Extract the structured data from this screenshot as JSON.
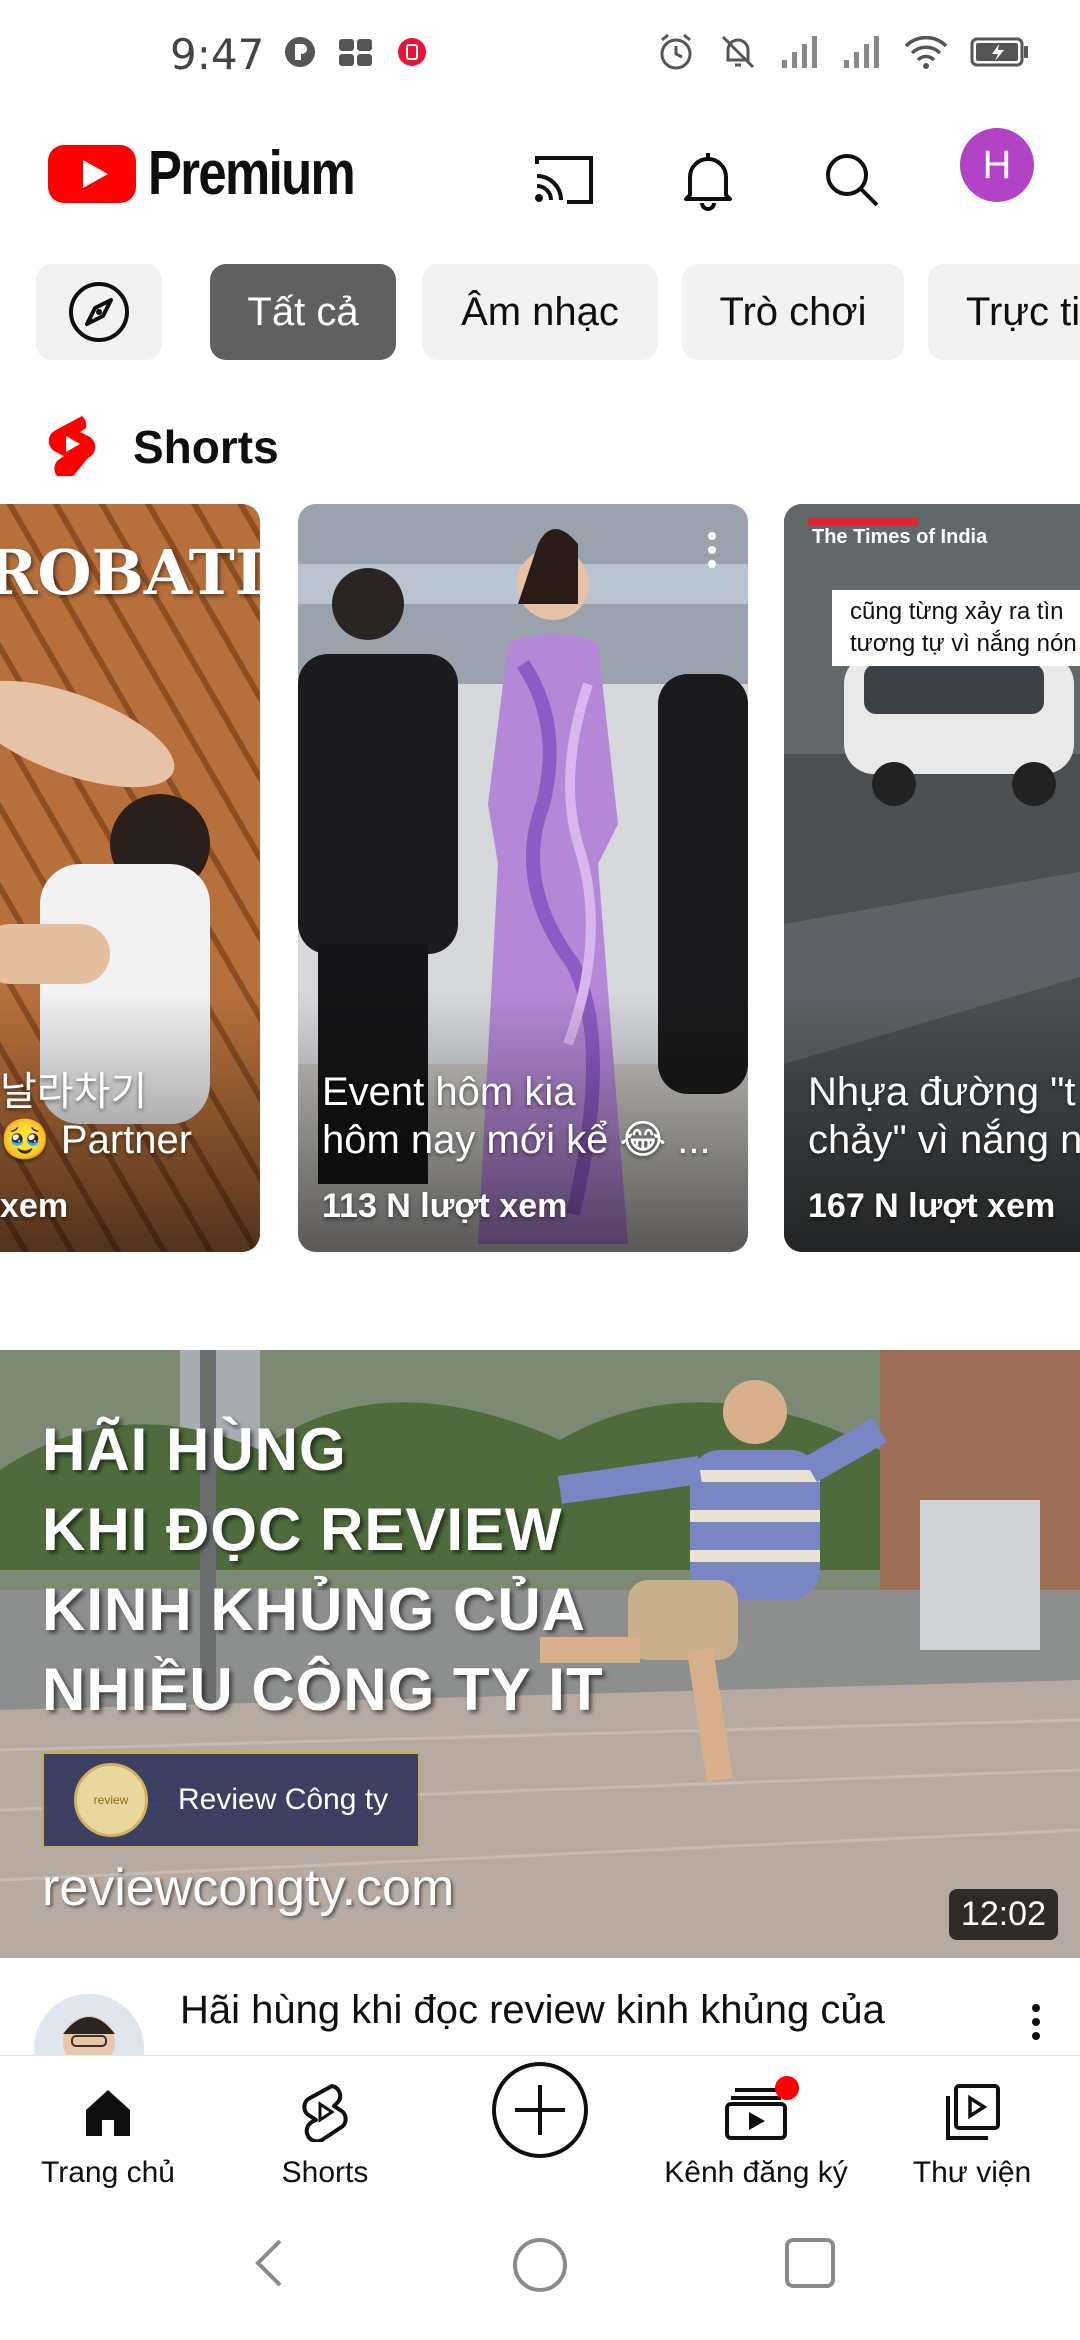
{
  "status_bar": {
    "time": "9:47"
  },
  "header": {
    "brand": "Premium",
    "avatar_letter": "H",
    "avatar_color": "#b243c6"
  },
  "chips": [
    {
      "label": "",
      "icon": "compass-icon"
    },
    {
      "label": "Tất cả"
    },
    {
      "label": "Âm nhạc"
    },
    {
      "label": "Trò chơi"
    },
    {
      "label": "Trực ti"
    }
  ],
  "shorts": {
    "section_title": "Shorts",
    "items": [
      {
        "overlay_text": "ROBATI",
        "caption": "날라차기\n🥹 Partner C...",
        "views": "xem"
      },
      {
        "caption": "Event hôm kia\nhôm nay mới kể 😂 ...",
        "views": "113 N lượt xem"
      },
      {
        "source": "The Times of India",
        "banner": "cũng từng xảy ra tìn\ntương tự vì nắng nón",
        "caption": "Nhựa đường \"t\nchảy\" vì nắng n",
        "views": "167 N lượt xem"
      }
    ]
  },
  "video": {
    "thumbnail_lines": [
      "HÃI HÙNG",
      "KHI ĐỌC REVIEW",
      "KINH KHỦNG CỦA",
      "NHIỀU CÔNG TY IT"
    ],
    "thumbnail_brand": "Review Công ty",
    "thumbnail_seal": "review",
    "thumbnail_site": "reviewcongty.com",
    "duration": "12:02",
    "title": "Hãi hùng khi đọc review kinh khủng của"
  },
  "bottom_nav": [
    {
      "label": "Trang chủ",
      "icon": "home-icon"
    },
    {
      "label": "Shorts",
      "icon": "shorts-icon"
    },
    {
      "label": "",
      "icon": "create-icon"
    },
    {
      "label": "Kênh đăng ký",
      "icon": "subscriptions-icon"
    },
    {
      "label": "Thư viện",
      "icon": "library-icon"
    }
  ],
  "colors": {
    "youtube_red": "#ff0000",
    "chip_active": "#606060",
    "chip_bg": "#f2f2f2"
  }
}
